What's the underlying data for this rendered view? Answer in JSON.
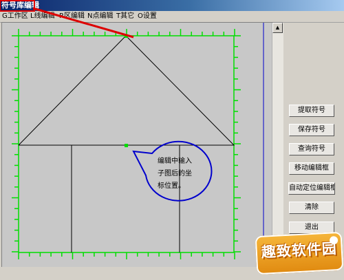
{
  "window": {
    "title": "符号库编辑"
  },
  "menu": [
    {
      "label": "G工作区"
    },
    {
      "label": "L线编辑"
    },
    {
      "label": "R区编辑"
    },
    {
      "label": "N点编辑"
    },
    {
      "label": "T其它"
    },
    {
      "label": "O设置"
    }
  ],
  "canvas": {
    "note_lines": [
      "编辑中输入",
      "子图后的坐",
      "标位置。"
    ],
    "colors": {
      "background": "#c8c8c8",
      "ruler": "#00dd00",
      "drawing": "#000000",
      "callout": "#0000cc",
      "annotation_line": "#dd0000"
    }
  },
  "buttons": [
    {
      "label": "提取符号"
    },
    {
      "label": "保存符号"
    },
    {
      "label": "查询符号"
    },
    {
      "label": "移动编辑框"
    },
    {
      "label": "自动定位编辑框"
    },
    {
      "label": "清除"
    },
    {
      "label": "退出"
    }
  ],
  "watermark": {
    "text": "趣致软件园"
  },
  "icons": {
    "scroll_up": "arrow-up-icon",
    "scroll_down": "arrow-down-icon"
  }
}
